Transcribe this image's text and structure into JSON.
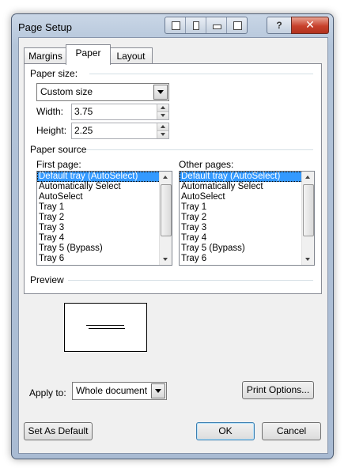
{
  "window": {
    "title": "Page Setup",
    "help_label": "?",
    "close_label": "✕"
  },
  "tabs": [
    {
      "label": "Margins",
      "active": false
    },
    {
      "label": "Paper",
      "active": true
    },
    {
      "label": "Layout",
      "active": false
    }
  ],
  "paper_size": {
    "group_label": "Paper size:",
    "selected": "Custom size",
    "width_label": "Width:",
    "width_value": "3.75",
    "height_label": "Height:",
    "height_value": "2.25"
  },
  "paper_source": {
    "group_label": "Paper source",
    "first_page_label": "First page:",
    "other_pages_label": "Other pages:",
    "trays": [
      "Default tray (AutoSelect)",
      "Automatically Select",
      "AutoSelect",
      "Tray 1",
      "Tray 2",
      "Tray 3",
      "Tray 4",
      "Tray 5 (Bypass)",
      "Tray 6"
    ],
    "first_selected": "Default tray (AutoSelect)",
    "other_selected": "Default tray (AutoSelect)"
  },
  "preview": {
    "group_label": "Preview",
    "apply_to_label": "Apply to:",
    "apply_to_value": "Whole document",
    "print_options_label": "Print Options..."
  },
  "footer": {
    "set_default_label": "Set As Default",
    "ok_label": "OK",
    "cancel_label": "Cancel"
  },
  "colors": {
    "selection": "#3399ff",
    "close_button": "#c7412c",
    "frame": "#b4c5da"
  },
  "icons": [
    "window-restore-icon",
    "window-dock-icon",
    "window-minimize-icon",
    "window-maximize-icon",
    "help-icon",
    "close-icon",
    "chevron-down-icon",
    "spin-up-icon",
    "spin-down-icon"
  ]
}
